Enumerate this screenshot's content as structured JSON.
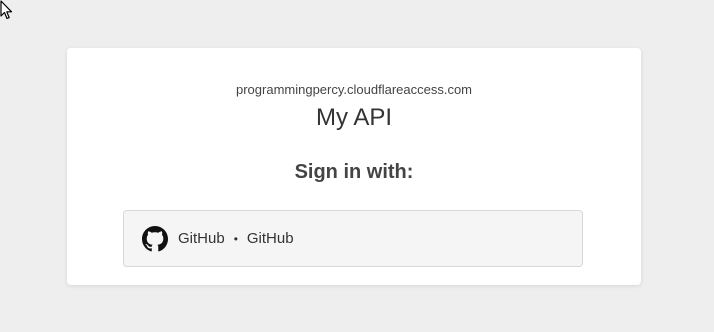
{
  "login": {
    "domain": "programmingpercy.cloudflareaccess.com",
    "app_title": "My API",
    "sign_in_heading": "Sign in with:",
    "provider": {
      "icon": "github-icon",
      "type": "GitHub",
      "separator": "•",
      "name": "GitHub"
    }
  }
}
